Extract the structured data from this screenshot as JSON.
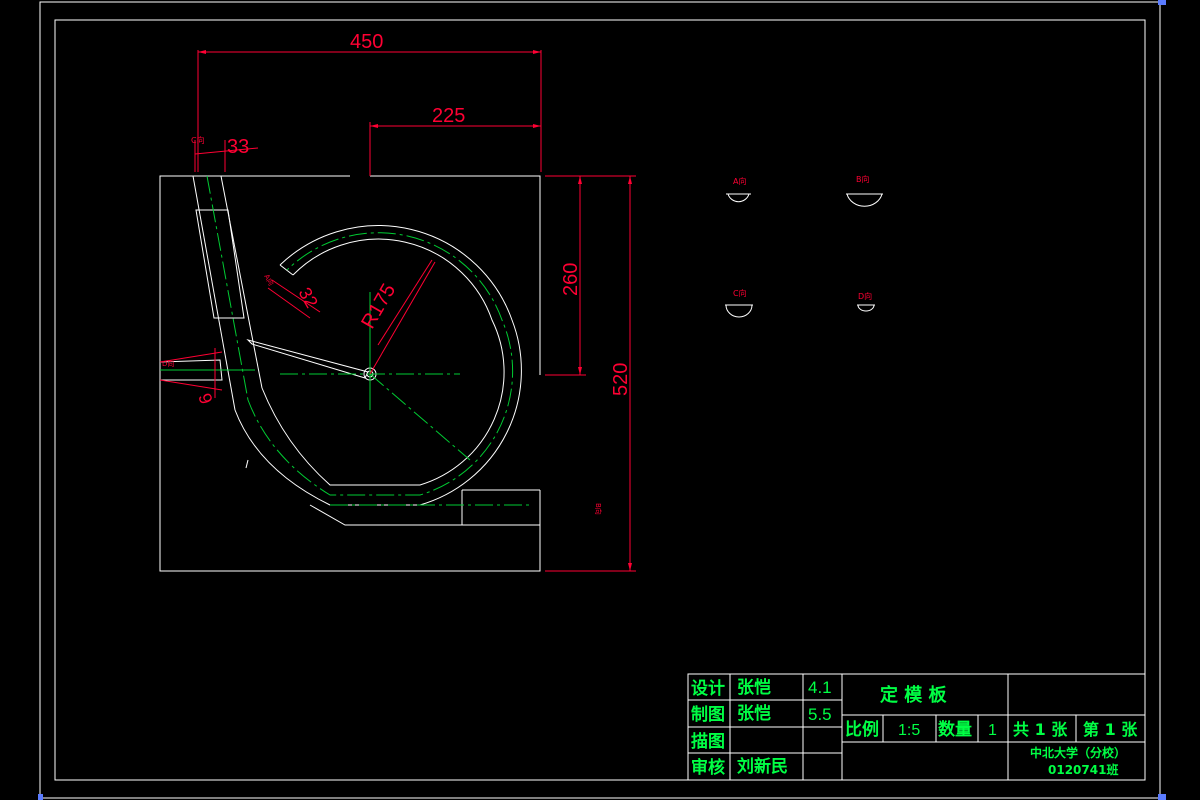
{
  "dimensions": {
    "width_450": "450",
    "width_225": "225",
    "tube_33": "33",
    "height_260": "260",
    "height_520": "520",
    "radius": "R175",
    "dim_32": "32",
    "dim_9": "9"
  },
  "view_labels": {
    "a": "A向",
    "b": "B向",
    "c": "C向",
    "d": "D向",
    "c_small": "C向",
    "b_side": "B向",
    "d_small": "D向",
    "a_small": "A向"
  },
  "title_block": {
    "design_label": "设计",
    "design_name": "张恺",
    "design_date": "4.1",
    "draw_label": "制图",
    "draw_name": "张恺",
    "draw_date": "5.5",
    "trace_label": "描图",
    "review_label": "审核",
    "review_name": "刘新民",
    "drawing_title": "定 模 板",
    "scale_label": "比例",
    "scale_value": "1:5",
    "qty_label": "数量",
    "qty_value": "1",
    "total_sheets": "共 1 张",
    "sheet_no": "第 1 张",
    "school": "中北大学（分校）",
    "class_code": "0120741班"
  },
  "colors": {
    "background": "#000000",
    "outline": "#ffffff",
    "dimension": "#ff0033",
    "centerline": "#00cc33",
    "text_green": "#00ff44"
  }
}
